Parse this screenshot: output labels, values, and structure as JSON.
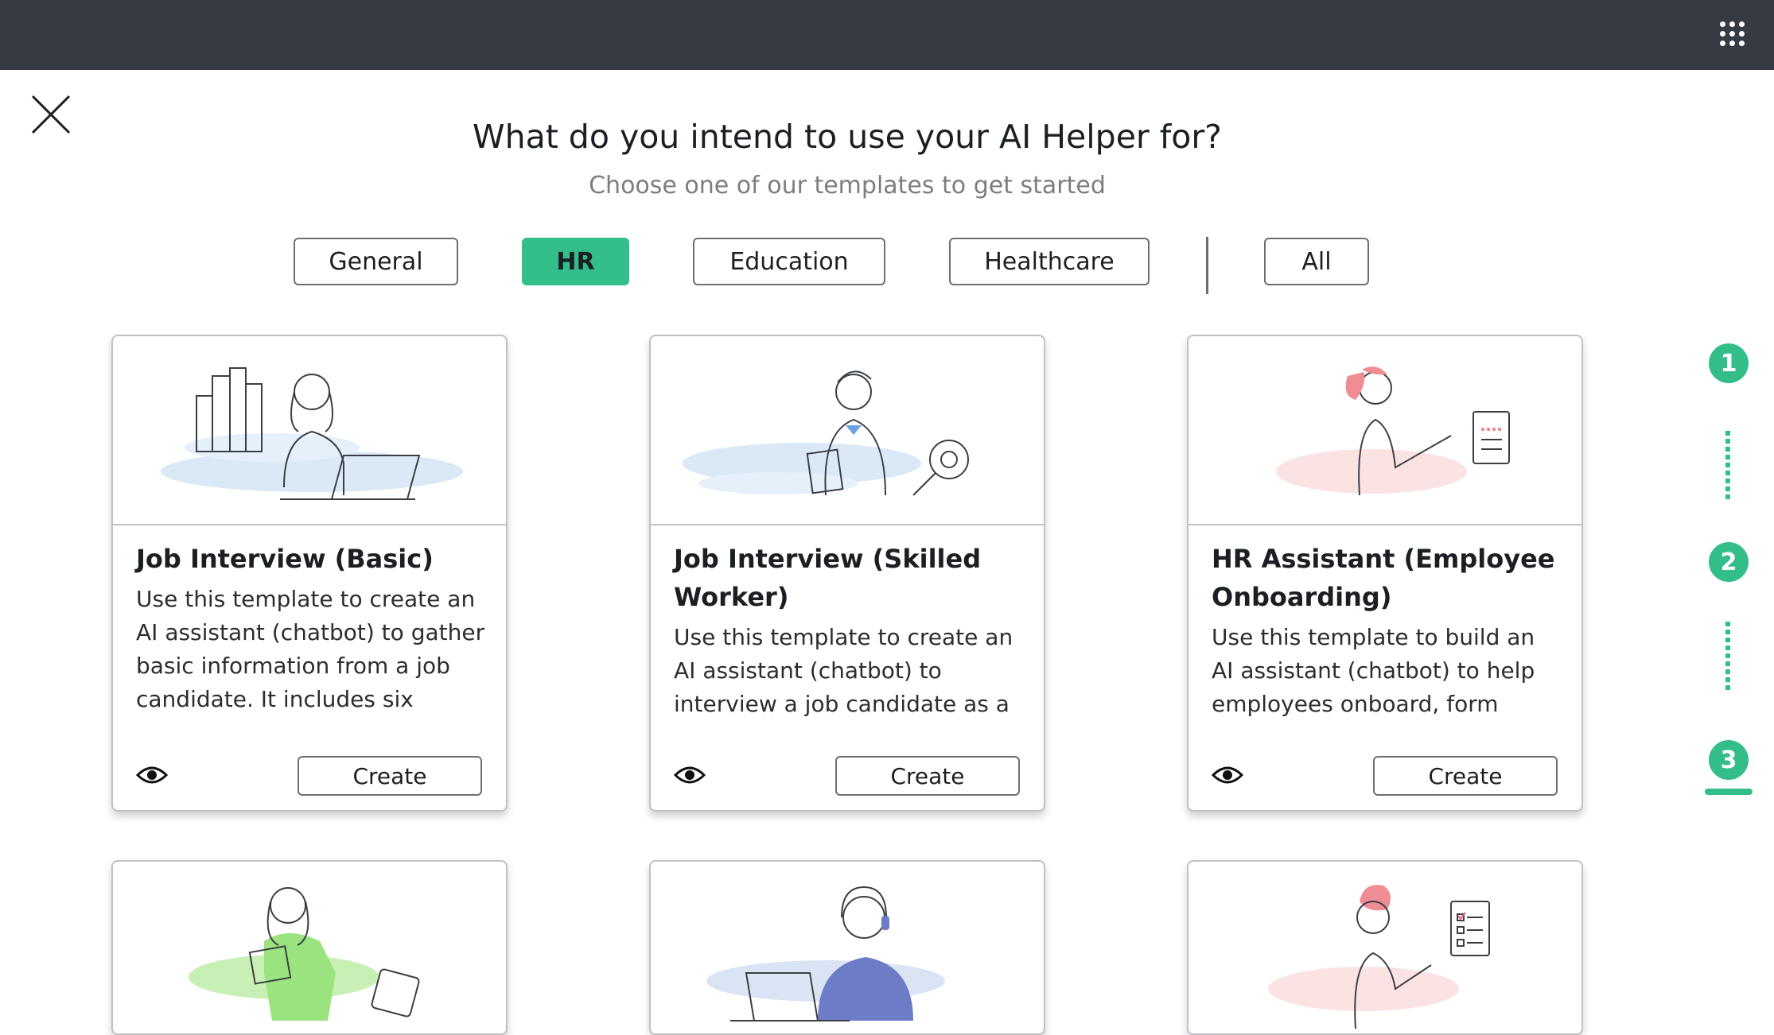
{
  "header": {
    "apps_icon": "grid-icon"
  },
  "close_icon": "close-icon",
  "title": "What do you intend to use your AI Helper for?",
  "subtitle": "Choose one of our templates to get started",
  "filters": [
    "General",
    "HR",
    "Education",
    "Healthcare",
    "All"
  ],
  "active_filter": "HR",
  "cards": [
    {
      "title": "Job Interview (Basic)",
      "description": "Use this template to create an AI assistant (chatbot) to gather basic information from a job candidate. It includes six",
      "create_label": "Create"
    },
    {
      "title": "Job Interview (Skilled Worker)",
      "description": "Use this template to create an AI assistant (chatbot) to interview a job candidate as a",
      "create_label": "Create"
    },
    {
      "title": "HR Assistant (Employee Onboarding)",
      "description": "Use this template to build an AI assistant (chatbot) to help employees onboard, form",
      "create_label": "Create"
    }
  ],
  "steps": [
    "1",
    "2",
    "3"
  ],
  "active_step": "3",
  "colors": {
    "accent": "#33bd89",
    "topbar": "#363a43"
  }
}
